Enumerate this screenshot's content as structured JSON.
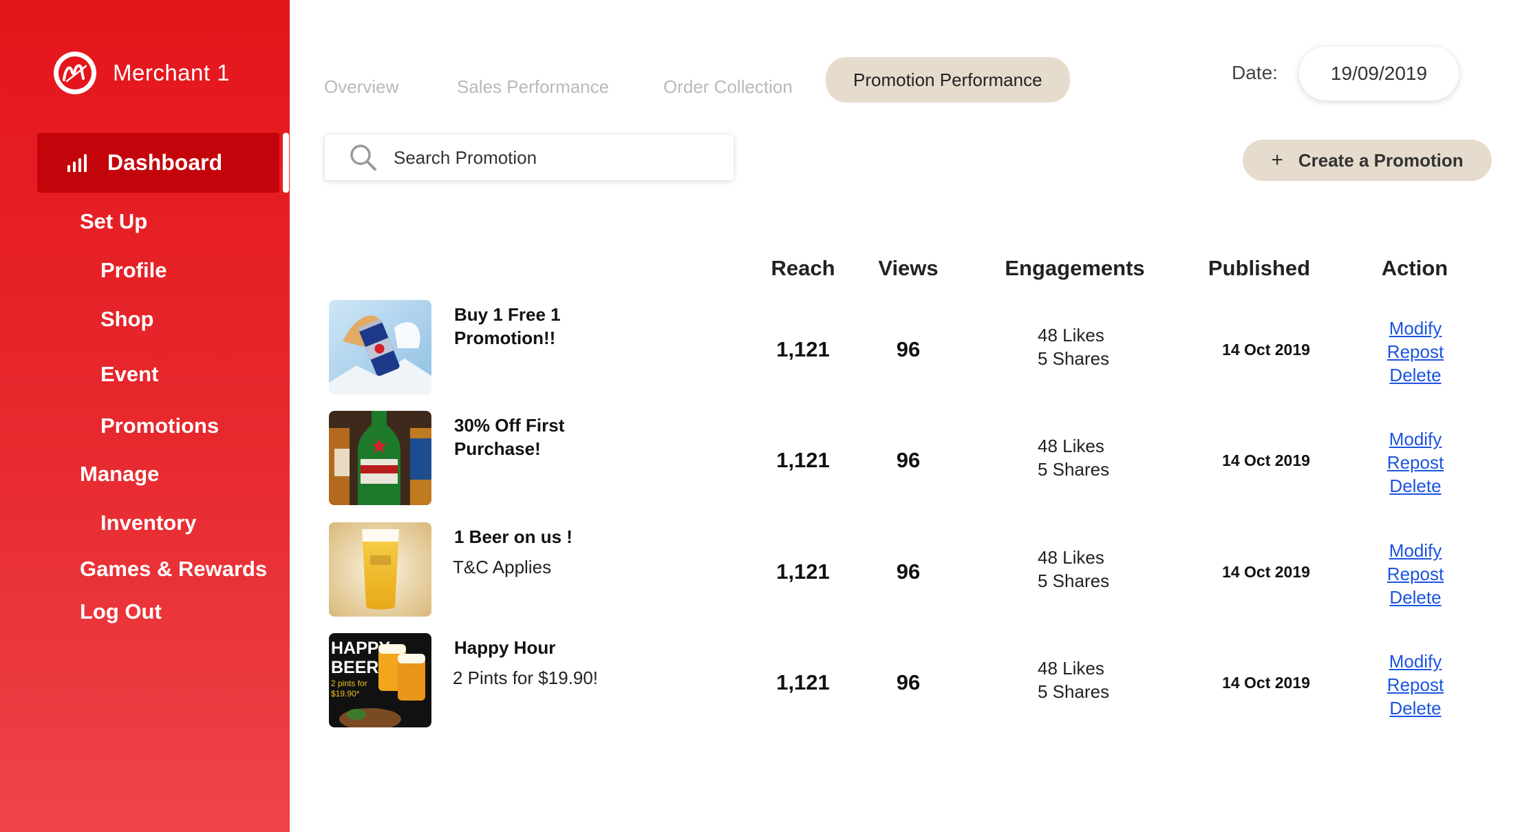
{
  "brand": {
    "name": "Merchant 1",
    "logo_icon": "merchant-m-logo"
  },
  "sidebar": {
    "active": {
      "label": "Dashboard",
      "icon": "bar-chart-icon"
    },
    "items": [
      {
        "label": "Set Up",
        "level": 1
      },
      {
        "label": "Profile",
        "level": 2
      },
      {
        "label": "Shop",
        "level": 2
      },
      {
        "label": "Event",
        "level": 2
      },
      {
        "label": "Promotions",
        "level": 2
      },
      {
        "label": "Manage",
        "level": 1
      },
      {
        "label": "Inventory",
        "level": 2
      },
      {
        "label": "Games & Rewards",
        "level": 1
      },
      {
        "label": "Log Out",
        "level": 1
      }
    ]
  },
  "tabs": [
    {
      "label": "Overview"
    },
    {
      "label": "Sales Performance"
    },
    {
      "label": "Order Collection"
    },
    {
      "label": "Promotion Performance",
      "active": true
    }
  ],
  "date": {
    "label": "Date:",
    "value": "19/09/2019"
  },
  "search": {
    "placeholder": "Search Promotion"
  },
  "create_button": {
    "plus": "+",
    "label": "Create a Promotion"
  },
  "table": {
    "headers": {
      "reach": "Reach",
      "views": "Views",
      "engagements": "Engagements",
      "published": "Published",
      "action": "Action"
    },
    "rows": [
      {
        "title": "Buy 1 Free 1 Promotion!!",
        "subtitle": "",
        "thumb": "energy-drink-can",
        "reach": "1,121",
        "views": "96",
        "likes": "48 Likes",
        "shares": "5 Shares",
        "published": "14 Oct 2019"
      },
      {
        "title": "30% Off First Purchase!",
        "subtitle": "",
        "thumb": "beer-bottles",
        "reach": "1,121",
        "views": "96",
        "likes": "48 Likes",
        "shares": "5 Shares",
        "published": "14 Oct 2019"
      },
      {
        "title": "1 Beer on us !",
        "subtitle": "T&C Applies",
        "thumb": "beer-glass",
        "reach": "1,121",
        "views": "96",
        "likes": "48 Likes",
        "shares": "5 Shares",
        "published": "14 Oct 2019"
      },
      {
        "title": "Happy Hour",
        "subtitle": "2 Pints for $19.90!",
        "thumb": "happy-beer-mugs",
        "thumb_text": [
          "HAPPY",
          "BEER",
          "2 pints for",
          "$19.90*"
        ],
        "reach": "1,121",
        "views": "96",
        "likes": "48 Likes",
        "shares": "5 Shares",
        "published": "14 Oct 2019"
      }
    ],
    "actions": {
      "modify": "Modify",
      "repost": "Repost",
      "delete": "Delete"
    }
  },
  "colors": {
    "sidebar_red": "#e4151b",
    "active_red": "#c4040b",
    "tab_active_bg": "#e6dccd",
    "link_blue": "#1a54e0"
  }
}
